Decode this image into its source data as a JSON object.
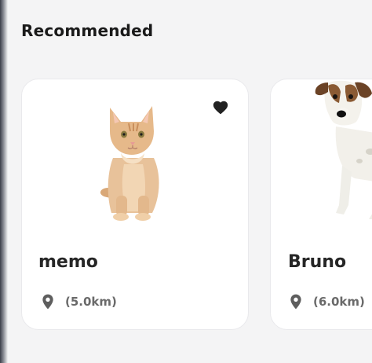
{
  "section": {
    "title": "Recommended"
  },
  "colors": {
    "background": "#f4f4f5",
    "card": "#ffffff",
    "title_text": "#1a1a1a",
    "muted_text": "#6a6a6a",
    "heart": "#222222"
  },
  "pets": [
    {
      "name": "memo",
      "distance": "(5.0km)",
      "species": "cat",
      "favorite": true,
      "icon": "heart-icon"
    },
    {
      "name": "Bruno",
      "distance": "(6.0km)",
      "species": "dog",
      "favorite": false,
      "icon": "location-pin-icon"
    }
  ]
}
